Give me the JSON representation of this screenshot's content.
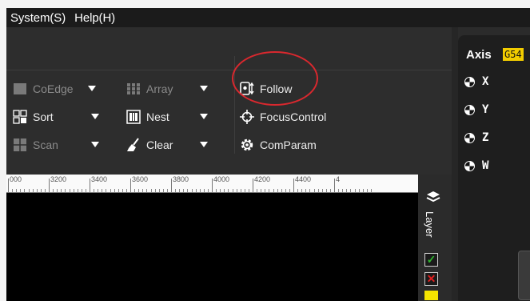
{
  "menubar": {
    "items": [
      "System(S)",
      "Help(H)"
    ]
  },
  "ribbon": {
    "coedge": "CoEdge",
    "array": "Array",
    "follow": "Follow",
    "sort": "Sort",
    "nest": "Nest",
    "focus_control": "FocusControl",
    "scan": "Scan",
    "clear": "Clear",
    "com_param": "ComParam"
  },
  "ruler": {
    "labels": [
      "000",
      "3200",
      "3400",
      "3600",
      "3800",
      "4000",
      "4200",
      "4400",
      "4"
    ]
  },
  "layer_panel": {
    "label": "Layer"
  },
  "axis_panel": {
    "title": "Axis",
    "coordinate_system": "G54",
    "axes": [
      "X",
      "Y",
      "Z",
      "W"
    ]
  },
  "colors": {
    "highlight_circle": "#d9282e",
    "g54_badge": "#f2cc00",
    "check": "#2fb52f",
    "cross": "#e02020"
  }
}
